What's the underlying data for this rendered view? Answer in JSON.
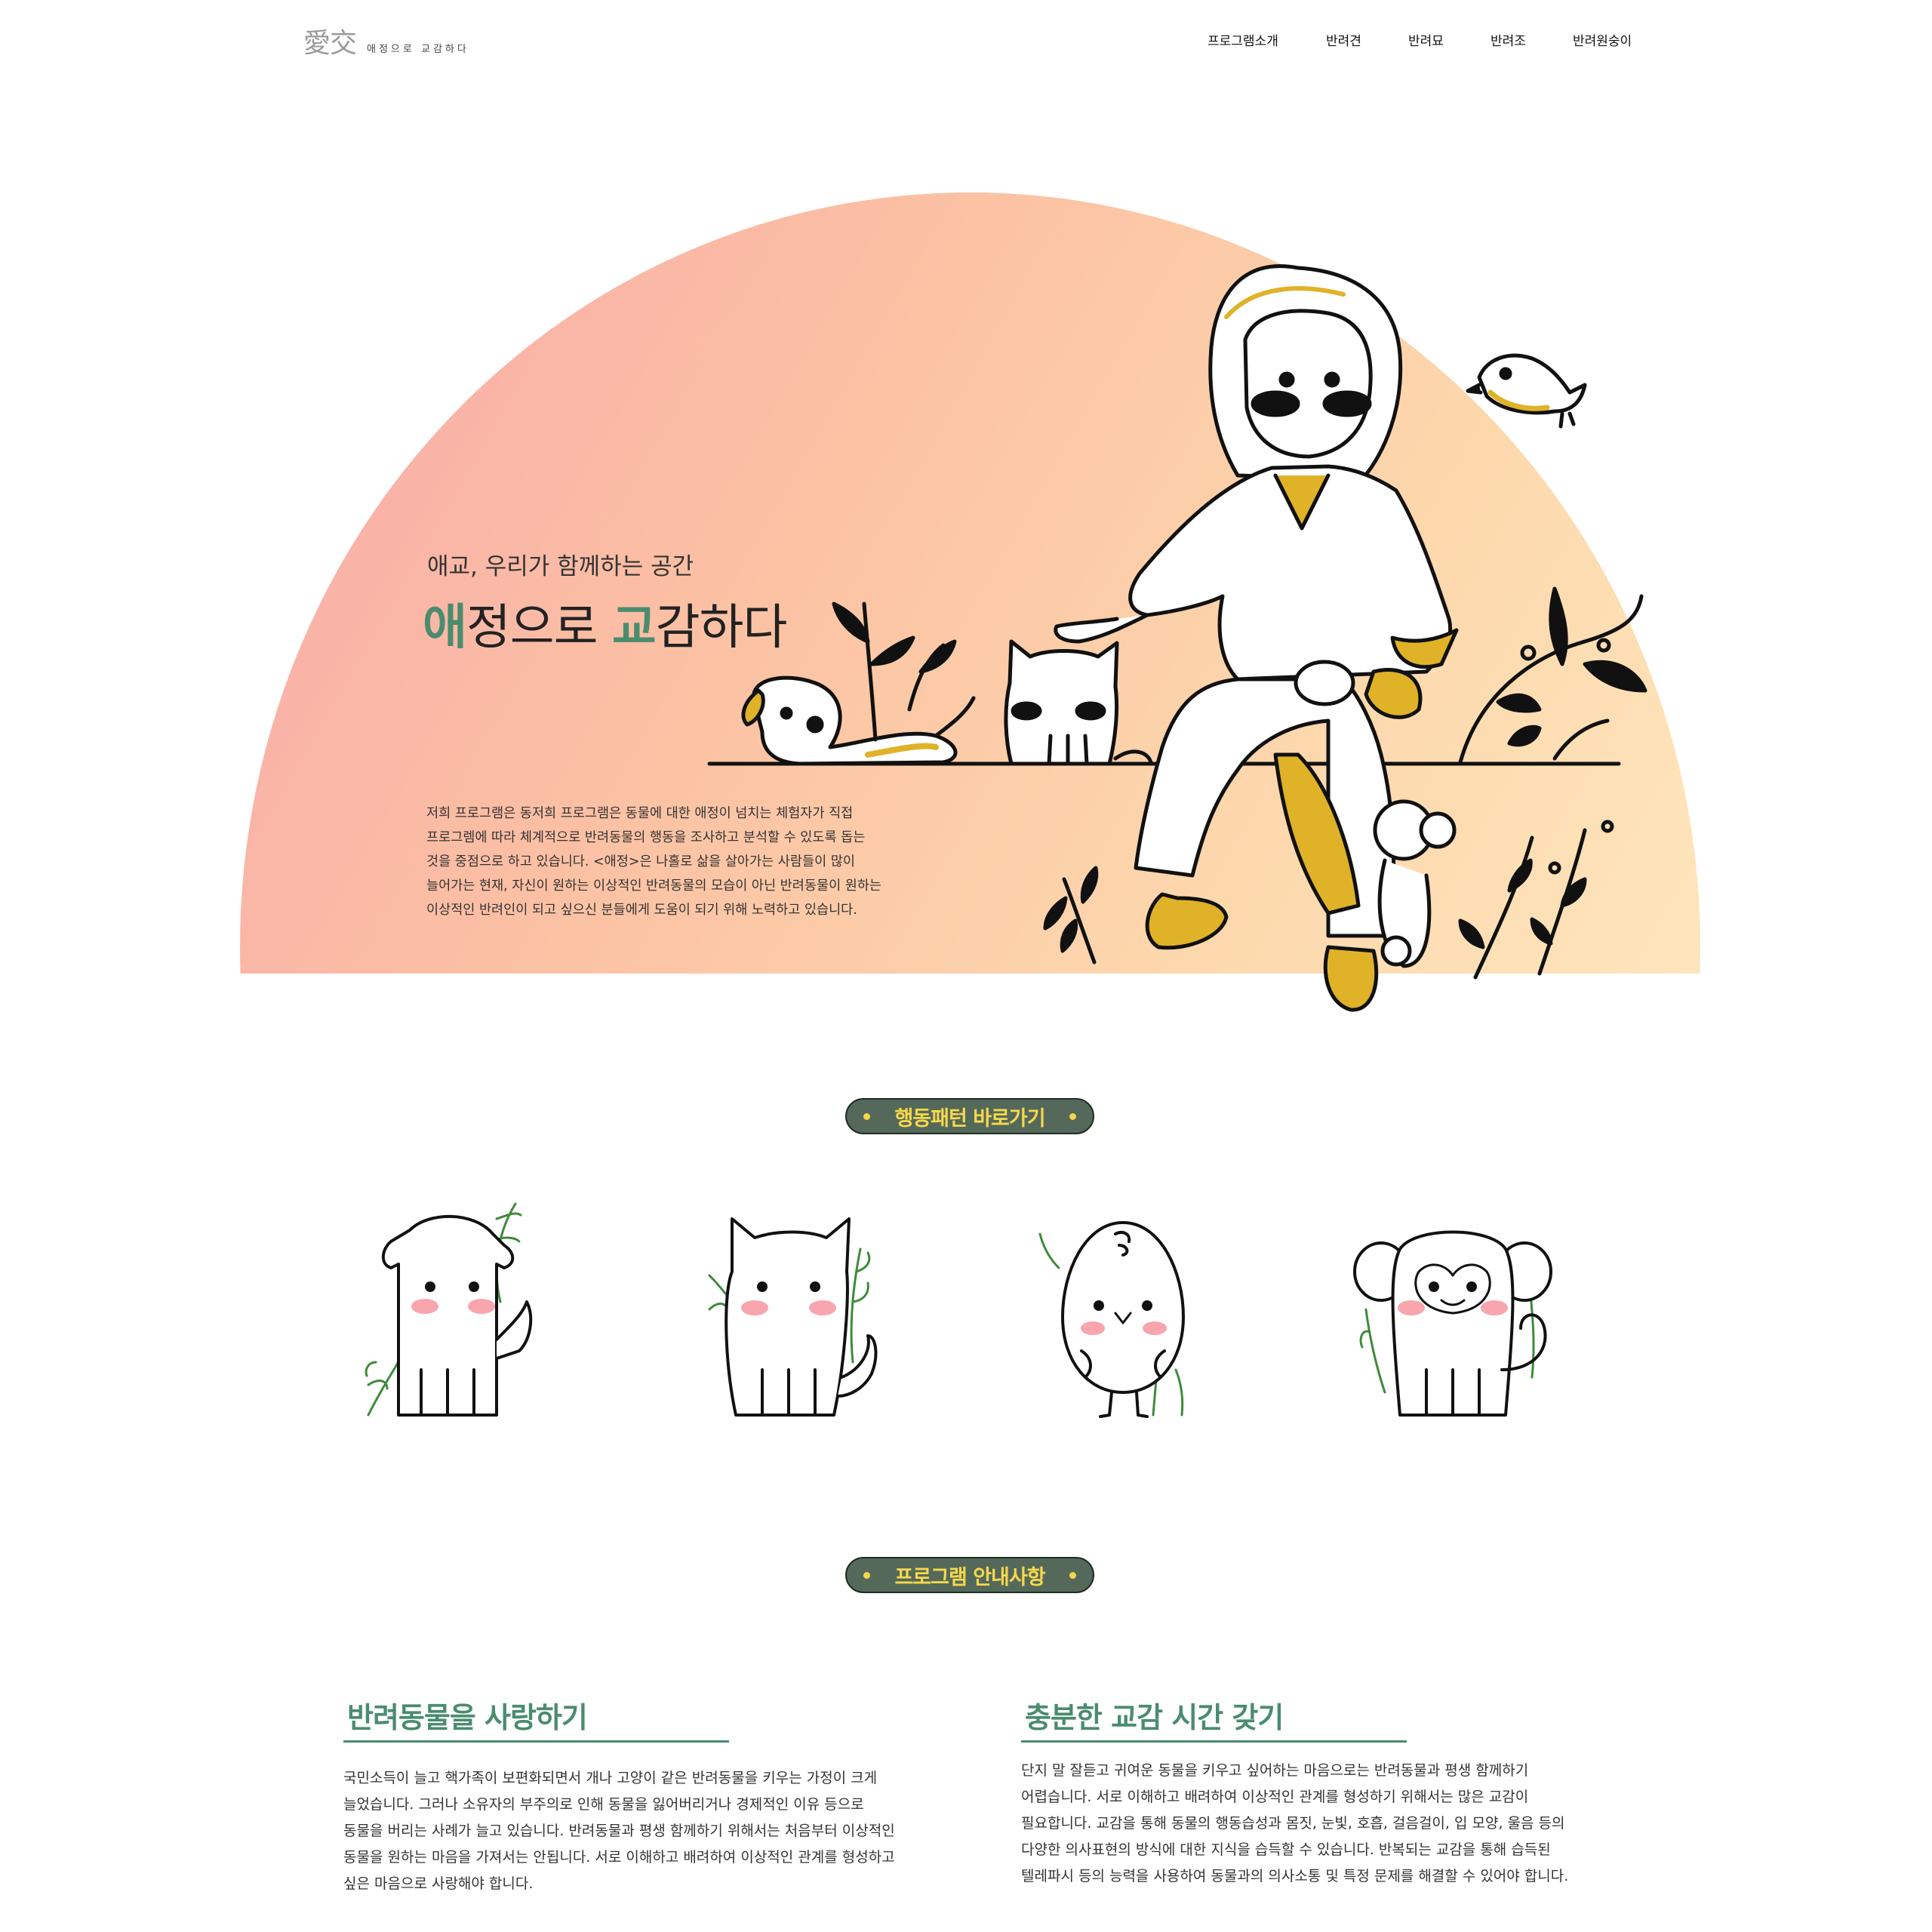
{
  "header": {
    "logo_mark": "愛交",
    "logo_sub": "애정으로 교감하다",
    "nav": [
      "프로그램소개",
      "반려견",
      "반려묘",
      "반려조",
      "반려원숭이"
    ]
  },
  "hero": {
    "subtitle": "애교, 우리가 함께하는 공간",
    "title_parts": [
      "애",
      "정으로 ",
      "교",
      "감하다"
    ],
    "description_lines": [
      "저희 프로그램은 동저희 프로그램은 동물에 대한 애정이 넘치는 체험자가 직접",
      "프로그렘에 따라 체계적으로 반려동물의 행동을 조사하고 분석할 수 있도록 돕는",
      "것을 중점으로 하고 있습니다. <애정>은 나홀로 삶을 살아가는 사람들이 많이",
      "늘어가는 현재, 자신이 원하는 이상적인 반려동물의 모습이 아닌 반려동물이 원하는",
      "이상적인 반려인이 되고 싶으신 분들에게 도움이 되기 위해 노력하고 있습니다."
    ]
  },
  "shortcut": {
    "label": "행동패턴 바로가기",
    "animals": [
      "dog-icon",
      "cat-icon",
      "bird-icon",
      "monkey-icon"
    ]
  },
  "program": {
    "label": "프로그램 안내사항",
    "sections": [
      {
        "title": "반려동물을 사랑하기",
        "lines": [
          "국민소득이 늘고 핵가족이 보편화되면서 개나 고양이 같은 반려동물을 키우는 가정이 크게",
          "늘었습니다. 그러나 소유자의 부주의로 인해 동물을 잃어버리거나 경제적인 이유 등으로",
          "동물을 버리는 사례가 늘고 있습니다. 반려동물과 평생 함께하기 위해서는 처음부터 이상적인",
          "동물을 원하는 마음을 가져서는 안됩니다. 서로 이해하고 배려하여 이상적인 관계를 형성하고",
          "싶은 마음으로 사랑해야 합니다."
        ]
      },
      {
        "title": "충분한 교감 시간 갖기",
        "lines": [
          "단지 말 잘듣고 귀여운 동물을 키우고 싶어하는 마음으로는 반려동물과 평생 함께하기",
          "어렵습니다. 서로 이해하고 배려하여 이상적인 관계를 형성하기 위해서는 많은 교감이",
          "필요합니다. 교감을 통해 동물의 행동습성과 몸짓, 눈빛, 호흡, 걸음걸이, 입 모양, 울음 등의",
          "다양한 의사표현의 방식에 대한 지식을 습득할 수 있습니다. 반복되는 교감을 통해 습득된",
          "텔레파시 등의 능력을 사용하여 동물과의 의사소통 및 특정 문제를 해결할 수 있어야 합니다."
        ]
      }
    ]
  },
  "colors": {
    "accent_green": "#4a8c6e",
    "pill_bg": "#54695a",
    "pill_text": "#f6d84b",
    "illustration_yellow": "#e0b228",
    "leaf_green": "#3f8a3a",
    "blush_pink": "#f8a5ad"
  }
}
